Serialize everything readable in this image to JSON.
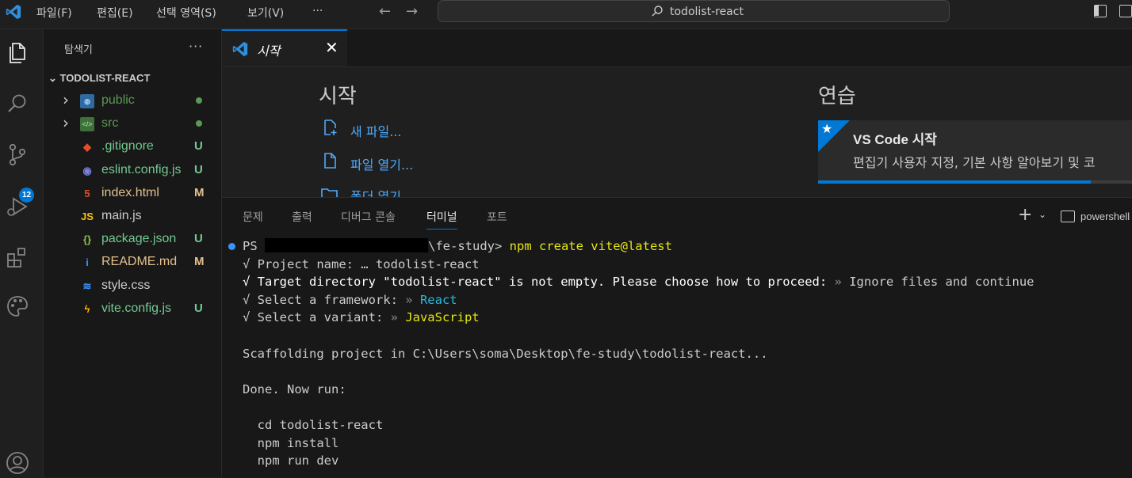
{
  "titlebar": {
    "menus": [
      "파일(F)",
      "편집(E)",
      "선택 영역(S)",
      "보기(V)",
      "···"
    ],
    "search_text": "todolist-react"
  },
  "activity": {
    "scm_badge": "12"
  },
  "sidebar": {
    "title": "탐색기",
    "more": "···",
    "root": "TODOLIST-REACT",
    "items": [
      {
        "name": "public",
        "type": "folder",
        "color": "#5a9a54",
        "status": "",
        "status_color": "#5a9a54",
        "icon_color": "#3794ff"
      },
      {
        "name": "src",
        "type": "folder",
        "color": "#5a9a54",
        "status": "",
        "status_color": "#5a9a54",
        "icon_color": "#5a9a54"
      },
      {
        "name": ".gitignore",
        "type": "file",
        "color": "#73c991",
        "status": "U",
        "status_color": "#73c991",
        "icon_color": "#e44d26"
      },
      {
        "name": "eslint.config.js",
        "type": "file",
        "color": "#73c991",
        "status": "U",
        "status_color": "#73c991",
        "icon_color": "#7b7fe0"
      },
      {
        "name": "index.html",
        "type": "file",
        "color": "#e2c08d",
        "status": "M",
        "status_color": "#e2c08d",
        "icon_color": "#e44d26"
      },
      {
        "name": "main.js",
        "type": "file",
        "color": "#cccccc",
        "status": "",
        "status_color": "#cccccc",
        "icon_color": "#f1c40f"
      },
      {
        "name": "package.json",
        "type": "file",
        "color": "#73c991",
        "status": "U",
        "status_color": "#73c991",
        "icon_color": "#8dc149"
      },
      {
        "name": "README.md",
        "type": "file",
        "color": "#e2c08d",
        "status": "M",
        "status_color": "#e2c08d",
        "icon_color": "#3794ff"
      },
      {
        "name": "style.css",
        "type": "file",
        "color": "#cccccc",
        "status": "",
        "status_color": "#cccccc",
        "icon_color": "#3794ff"
      },
      {
        "name": "vite.config.js",
        "type": "file",
        "color": "#73c991",
        "status": "U",
        "status_color": "#73c991",
        "icon_color": "#ffb300"
      }
    ]
  },
  "editor": {
    "tab_label": "시작",
    "tab_close": "✕",
    "welcome": {
      "start_heading": "시작",
      "links": [
        "새 파일...",
        "파일 열기...",
        "폴더 열기..."
      ],
      "walkthrough_heading": "연습",
      "card_title": "VS Code 시작",
      "card_desc": "편집기 사용자 지정, 기본 사항 알아보기 및 코",
      "card_progress": 0.82
    }
  },
  "panel": {
    "tabs": [
      "문제",
      "출력",
      "디버그 콘솔",
      "터미널",
      "포트"
    ],
    "active_tab": "터미널",
    "profile": "powershell",
    "terminal": {
      "prompt_prefix": "PS ",
      "prompt_suffix": "\\fe-study> ",
      "command": "npm create vite@latest",
      "line_project_name": "√ Project name: … todolist-react",
      "line_target_label": "√ Target directory \"todolist-react\" is not empty. Please choose how to proceed:",
      "line_target_arrow": " » ",
      "line_target_value": "Ignore files and continue",
      "line_framework_label": "√ Select a framework:",
      "line_framework_arrow": " » ",
      "line_framework_value": "React",
      "line_variant_label": "√ Select a variant:",
      "line_variant_arrow": " » ",
      "line_variant_value": "JavaScript",
      "line_scaffold": "Scaffolding project in C:\\Users\\soma\\Desktop\\fe-study\\todolist-react...",
      "line_done": "Done. Now run:",
      "line_cd": "  cd todolist-react",
      "line_install": "  npm install",
      "line_dev": "  npm run dev"
    }
  }
}
